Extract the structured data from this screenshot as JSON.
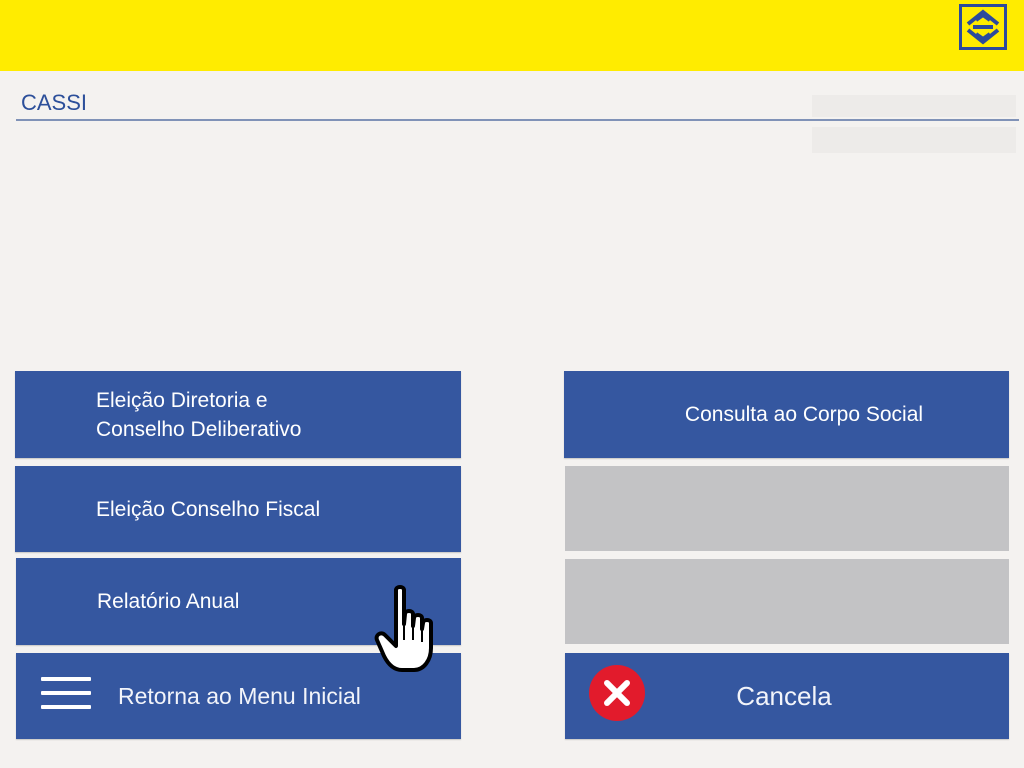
{
  "header": {
    "logo_icon": "banco-do-brasil-logo",
    "bar_color": "#ffec00"
  },
  "page": {
    "title": "CASSI"
  },
  "menu": {
    "btn_eleicao_diretoria": "Eleição Diretoria e\nConselho Deliberativo",
    "btn_eleicao_fiscal": "Eleição Conselho Fiscal",
    "btn_relatorio": "Relatório Anual",
    "btn_consulta": "Consulta ao Corpo Social",
    "btn_retorna": "Retorna ao Menu Inicial",
    "btn_cancela": "Cancela"
  },
  "icons": {
    "menu": "hamburger-icon",
    "cancel": "close-circle-icon",
    "pointer": "hand-pointer-icon"
  },
  "colors": {
    "button": "#3557a0",
    "button_disabled": "#c3c3c5",
    "cancel_red": "#e21b2c"
  }
}
